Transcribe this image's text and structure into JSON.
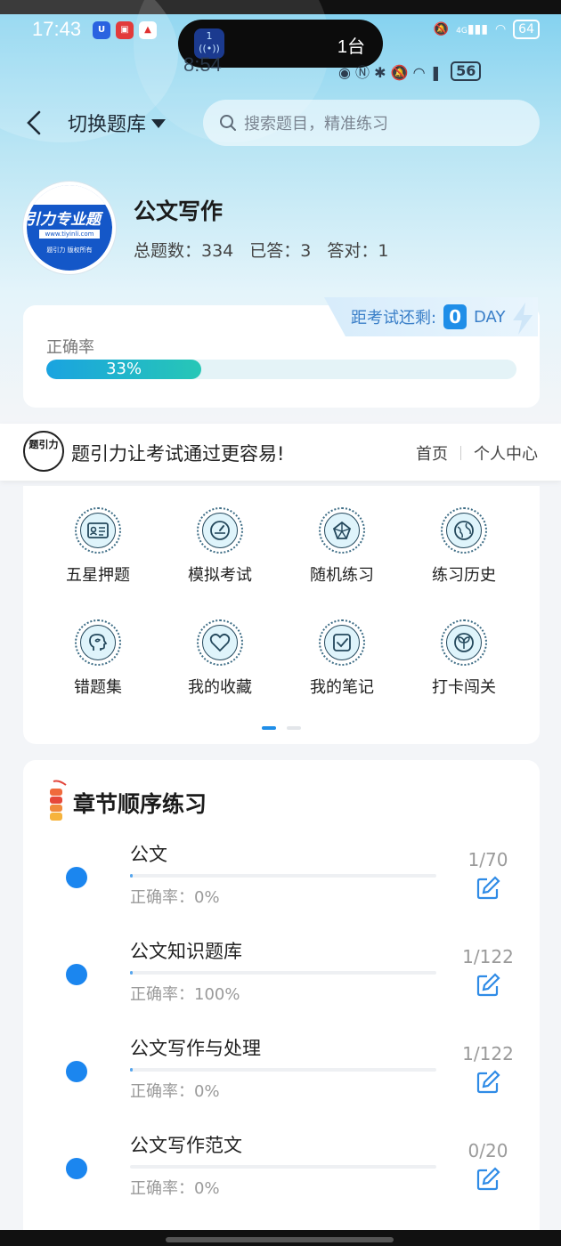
{
  "status_bar": {
    "time": "17:43",
    "island_count": "1台",
    "battery": "64",
    "network": "4G",
    "overlay_time": "8:54",
    "overlay_battery": "56"
  },
  "header": {
    "switch_label": "切换题库",
    "search_placeholder": "搜索题目，精准练习"
  },
  "subject": {
    "logo_text": "引力专业题",
    "logo_url": "www.tiyinli.com",
    "logo_copyright": "题引力 版权所有",
    "title": "公文写作",
    "total": "总题数：334",
    "answered": "已答：3",
    "correct": "答对：1"
  },
  "exam": {
    "countdown_label": "距考试还剩:",
    "days": "0",
    "unit": "DAY",
    "accuracy_label": "正确率",
    "accuracy": "33%",
    "accuracy_fraction": 0.33
  },
  "brand": {
    "logo_text": "题引力",
    "slogan": "题引力让考试通过更容易!",
    "home": "首页",
    "profile": "个人中心"
  },
  "menu": [
    {
      "label": "五星押题",
      "icon": "id-card-icon"
    },
    {
      "label": "模拟考试",
      "icon": "gauge-icon"
    },
    {
      "label": "随机练习",
      "icon": "network-icon"
    },
    {
      "label": "练习历史",
      "icon": "globe-icon"
    },
    {
      "label": "错题集",
      "icon": "brain-icon"
    },
    {
      "label": "我的收藏",
      "icon": "heart-icon"
    },
    {
      "label": "我的笔记",
      "icon": "checkbox-icon"
    },
    {
      "label": "打卡闯关",
      "icon": "sprout-icon"
    }
  ],
  "chapters": {
    "title": "章节顺序练习",
    "items": [
      {
        "name": "公文",
        "accuracy": "正确率：0%",
        "count": "1/70"
      },
      {
        "name": "公文知识题库",
        "accuracy": "正确率：100%",
        "count": "1/122"
      },
      {
        "name": "公文写作与处理",
        "accuracy": "正确率：0%",
        "count": "1/122"
      },
      {
        "name": "公文写作范文",
        "accuracy": "正确率：0%",
        "count": "0/20"
      }
    ]
  },
  "colors": {
    "accent": "#1f8ee8",
    "dot": "#1b86ef",
    "progress_start": "#1aa3e0",
    "progress_end": "#27c7b6"
  }
}
